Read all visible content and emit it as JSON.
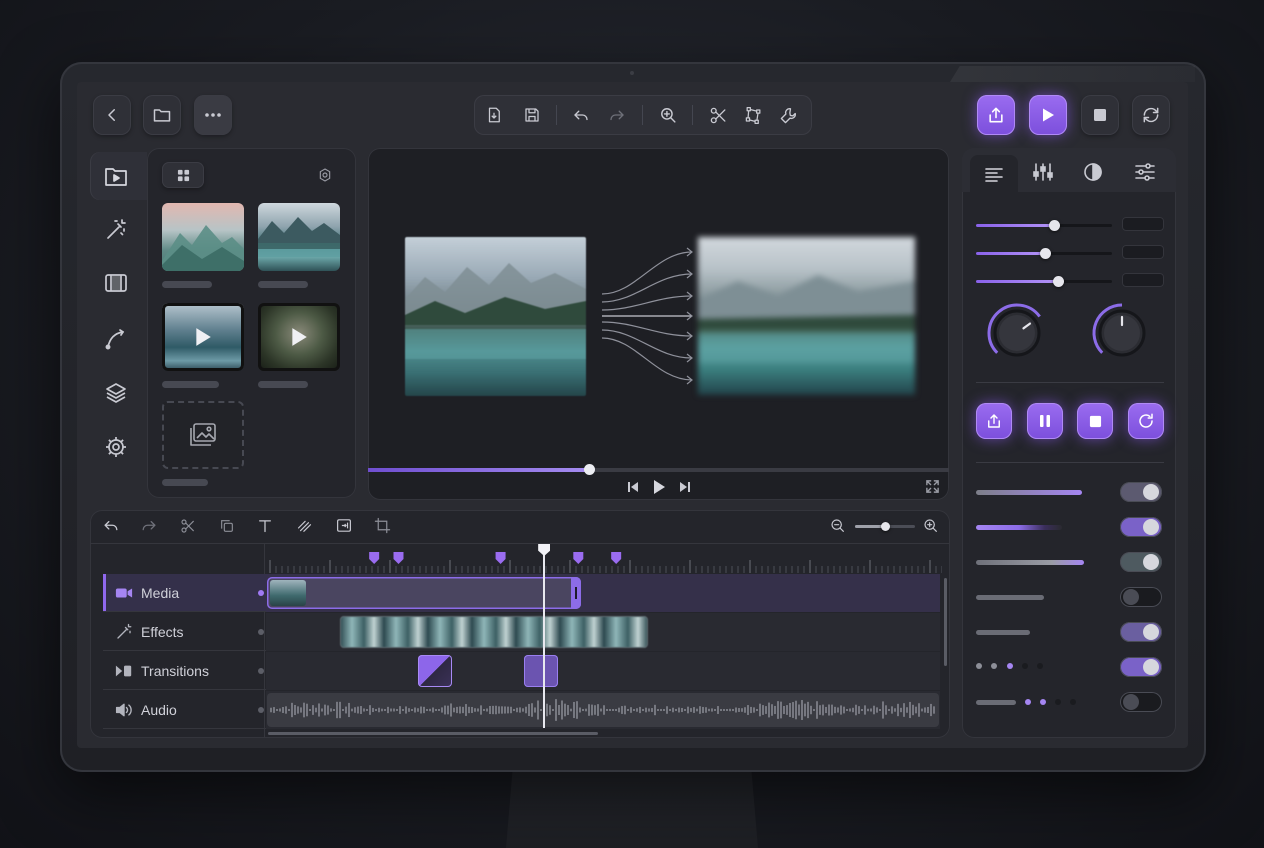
{
  "top_toolbar": {
    "left": [
      "back",
      "folder",
      "more"
    ],
    "center": [
      "import-file",
      "save",
      "undo",
      "redo",
      "zoom",
      "cut",
      "crop-transform",
      "wrench"
    ],
    "right": [
      "export",
      "play",
      "stop",
      "refresh"
    ]
  },
  "media_panel": {
    "sidebar_tabs": [
      "media",
      "magic-wand",
      "film",
      "curve",
      "layers",
      "settings"
    ],
    "thumbnails": [
      {
        "kind": "image"
      },
      {
        "kind": "image"
      },
      {
        "kind": "video"
      },
      {
        "kind": "video"
      },
      {
        "kind": "empty"
      }
    ]
  },
  "preview": {
    "progress": 0.38
  },
  "timeline": {
    "zoom_level": 0.5,
    "playhead_fraction": 0.41,
    "tracks": [
      {
        "label": "Media",
        "icon": "camera-icon",
        "active": true
      },
      {
        "label": "Effects",
        "icon": "magic-wand-icon",
        "active": false
      },
      {
        "label": "Transitions",
        "icon": "transition-icon",
        "active": false
      },
      {
        "label": "Audio",
        "icon": "speaker-icon",
        "active": false
      }
    ]
  },
  "inspector": {
    "tabs": [
      "align",
      "mixer",
      "contrast",
      "sliders"
    ],
    "sliders": [
      0.57,
      0.51,
      0.6
    ],
    "knobs": [
      0.7,
      0.5
    ],
    "toggles": [
      true,
      true,
      true,
      false,
      true,
      true,
      false
    ],
    "colors": {
      "accent": "#8a62ea",
      "panel": "#24252b",
      "background": "#2a2b31"
    }
  }
}
